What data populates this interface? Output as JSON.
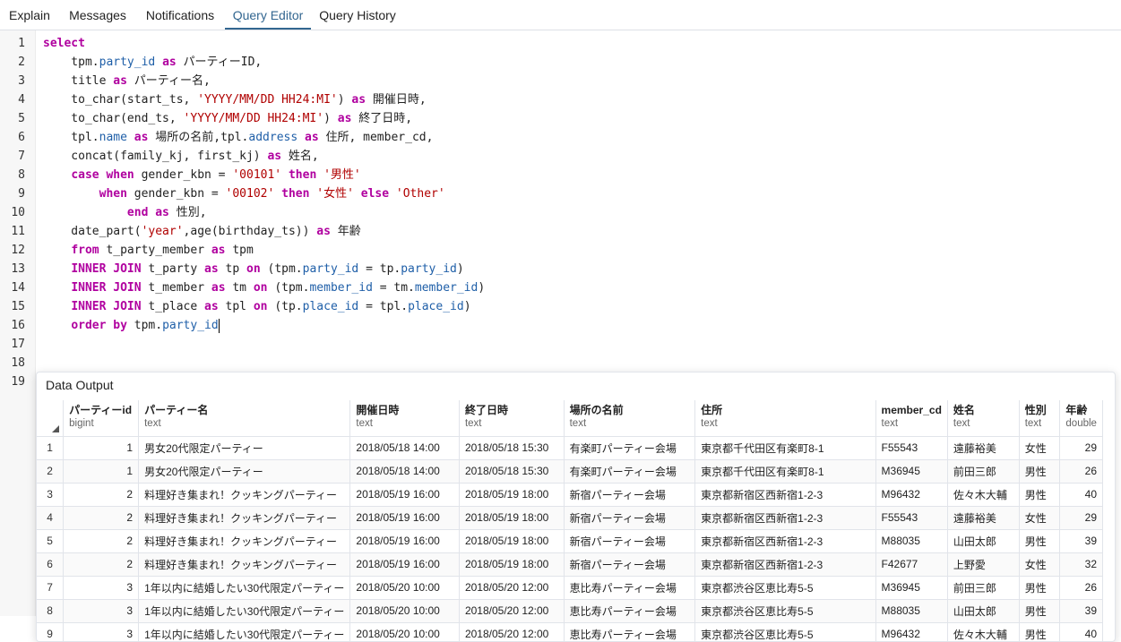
{
  "tabs": [
    {
      "label": "Explain",
      "active": false
    },
    {
      "label": "Messages",
      "active": false
    },
    {
      "label": "Notifications",
      "active": false
    },
    {
      "label": "Query Editor",
      "active": true
    },
    {
      "label": "Query History",
      "active": false
    }
  ],
  "editor": {
    "line_numbers": [
      "1",
      "2",
      "3",
      "4",
      "5",
      "6",
      "7",
      "8",
      "9",
      "10",
      "11",
      "12",
      "13",
      "14",
      "15",
      "16",
      "17",
      "18",
      "19"
    ],
    "lines": [
      [
        {
          "t": "select",
          "c": "kw"
        }
      ],
      [
        {
          "t": "    tpm."
        },
        {
          "t": "party_id",
          "c": "prop"
        },
        {
          "t": " "
        },
        {
          "t": "as",
          "c": "kw"
        },
        {
          "t": " パーティーID,"
        }
      ],
      [
        {
          "t": "    title "
        },
        {
          "t": "as",
          "c": "kw"
        },
        {
          "t": " パーティー名,"
        }
      ],
      [
        {
          "t": "    to_char(start_ts, "
        },
        {
          "t": "'YYYY/MM/DD HH24:MI'",
          "c": "str"
        },
        {
          "t": ") "
        },
        {
          "t": "as",
          "c": "kw"
        },
        {
          "t": " 開催日時,"
        }
      ],
      [
        {
          "t": "    to_char(end_ts, "
        },
        {
          "t": "'YYYY/MM/DD HH24:MI'",
          "c": "str"
        },
        {
          "t": ") "
        },
        {
          "t": "as",
          "c": "kw"
        },
        {
          "t": " 終了日時,"
        }
      ],
      [
        {
          "t": "    tpl."
        },
        {
          "t": "name",
          "c": "prop"
        },
        {
          "t": " "
        },
        {
          "t": "as",
          "c": "kw"
        },
        {
          "t": " 場所の名前,tpl."
        },
        {
          "t": "address",
          "c": "prop"
        },
        {
          "t": " "
        },
        {
          "t": "as",
          "c": "kw"
        },
        {
          "t": " 住所, member_cd,"
        }
      ],
      [
        {
          "t": "    concat(family_kj, first_kj) "
        },
        {
          "t": "as",
          "c": "kw"
        },
        {
          "t": " 姓名,"
        }
      ],
      [
        {
          "t": "    "
        },
        {
          "t": "case when",
          "c": "kw"
        },
        {
          "t": " gender_kbn = "
        },
        {
          "t": "'00101'",
          "c": "str"
        },
        {
          "t": " "
        },
        {
          "t": "then",
          "c": "kw"
        },
        {
          "t": " "
        },
        {
          "t": "'男性'",
          "c": "str"
        }
      ],
      [
        {
          "t": "        "
        },
        {
          "t": "when",
          "c": "kw"
        },
        {
          "t": " gender_kbn = "
        },
        {
          "t": "'00102'",
          "c": "str"
        },
        {
          "t": " "
        },
        {
          "t": "then",
          "c": "kw"
        },
        {
          "t": " "
        },
        {
          "t": "'女性'",
          "c": "str"
        },
        {
          "t": " "
        },
        {
          "t": "else",
          "c": "kw"
        },
        {
          "t": " "
        },
        {
          "t": "'Other'",
          "c": "str"
        }
      ],
      [
        {
          "t": "            "
        },
        {
          "t": "end as",
          "c": "kw"
        },
        {
          "t": " 性別,"
        }
      ],
      [
        {
          "t": "    date_part("
        },
        {
          "t": "'year'",
          "c": "str"
        },
        {
          "t": ",age(birthday_ts)) "
        },
        {
          "t": "as",
          "c": "kw"
        },
        {
          "t": " 年齢"
        }
      ],
      [
        {
          "t": "    "
        },
        {
          "t": "from",
          "c": "kw"
        },
        {
          "t": " t_party_member "
        },
        {
          "t": "as",
          "c": "kw"
        },
        {
          "t": " tpm"
        }
      ],
      [
        {
          "t": "    "
        },
        {
          "t": "INNER JOIN",
          "c": "kw"
        },
        {
          "t": " t_party "
        },
        {
          "t": "as",
          "c": "kw"
        },
        {
          "t": " tp "
        },
        {
          "t": "on",
          "c": "kw"
        },
        {
          "t": " (tpm."
        },
        {
          "t": "party_id",
          "c": "prop"
        },
        {
          "t": " = tp."
        },
        {
          "t": "party_id",
          "c": "prop"
        },
        {
          "t": ")"
        }
      ],
      [
        {
          "t": "    "
        },
        {
          "t": "INNER JOIN",
          "c": "kw"
        },
        {
          "t": " t_member "
        },
        {
          "t": "as",
          "c": "kw"
        },
        {
          "t": " tm "
        },
        {
          "t": "on",
          "c": "kw"
        },
        {
          "t": " (tpm."
        },
        {
          "t": "member_id",
          "c": "prop"
        },
        {
          "t": " = tm."
        },
        {
          "t": "member_id",
          "c": "prop"
        },
        {
          "t": ")"
        }
      ],
      [
        {
          "t": "    "
        },
        {
          "t": "INNER JOIN",
          "c": "kw"
        },
        {
          "t": " t_place "
        },
        {
          "t": "as",
          "c": "kw"
        },
        {
          "t": " tpl "
        },
        {
          "t": "on",
          "c": "kw"
        },
        {
          "t": " (tp."
        },
        {
          "t": "place_id",
          "c": "prop"
        },
        {
          "t": " = tpl."
        },
        {
          "t": "place_id",
          "c": "prop"
        },
        {
          "t": ")"
        }
      ],
      [
        {
          "t": "    "
        },
        {
          "t": "order by",
          "c": "kw"
        },
        {
          "t": " tpm."
        },
        {
          "t": "party_id",
          "c": "prop"
        },
        {
          "t": "",
          "c": "cursor"
        }
      ],
      [],
      [],
      []
    ]
  },
  "output": {
    "title": "Data Output",
    "columns": [
      {
        "name": "パーティーid",
        "type": "bigint",
        "num": true
      },
      {
        "name": "パーティー名",
        "type": "text"
      },
      {
        "name": "開催日時",
        "type": "text"
      },
      {
        "name": "終了日時",
        "type": "text"
      },
      {
        "name": "場所の名前",
        "type": "text"
      },
      {
        "name": "住所",
        "type": "text"
      },
      {
        "name": "member_cd",
        "type": "text"
      },
      {
        "name": "姓名",
        "type": "text"
      },
      {
        "name": "性別",
        "type": "text"
      },
      {
        "name": "年齢",
        "type": "double",
        "num": true
      }
    ],
    "rows": [
      [
        "1",
        "1",
        "男女20代限定パーティー",
        "2018/05/18 14:00",
        "2018/05/18 15:30",
        "有楽町パーティー会場",
        "東京都千代田区有楽町8-1",
        "F55543",
        "遠藤裕美",
        "女性",
        "29"
      ],
      [
        "2",
        "1",
        "男女20代限定パーティー",
        "2018/05/18 14:00",
        "2018/05/18 15:30",
        "有楽町パーティー会場",
        "東京都千代田区有楽町8-1",
        "M36945",
        "前田三郎",
        "男性",
        "26"
      ],
      [
        "3",
        "2",
        "料理好き集まれ！クッキングパーティー",
        "2018/05/19 16:00",
        "2018/05/19 18:00",
        "新宿パーティー会場",
        "東京都新宿区西新宿1-2-3",
        "M96432",
        "佐々木大輔",
        "男性",
        "40"
      ],
      [
        "4",
        "2",
        "料理好き集まれ！クッキングパーティー",
        "2018/05/19 16:00",
        "2018/05/19 18:00",
        "新宿パーティー会場",
        "東京都新宿区西新宿1-2-3",
        "F55543",
        "遠藤裕美",
        "女性",
        "29"
      ],
      [
        "5",
        "2",
        "料理好き集まれ！クッキングパーティー",
        "2018/05/19 16:00",
        "2018/05/19 18:00",
        "新宿パーティー会場",
        "東京都新宿区西新宿1-2-3",
        "M88035",
        "山田太郎",
        "男性",
        "39"
      ],
      [
        "6",
        "2",
        "料理好き集まれ！クッキングパーティー",
        "2018/05/19 16:00",
        "2018/05/19 18:00",
        "新宿パーティー会場",
        "東京都新宿区西新宿1-2-3",
        "F42677",
        "上野愛",
        "女性",
        "32"
      ],
      [
        "7",
        "3",
        "1年以内に結婚したい30代限定パーティー",
        "2018/05/20 10:00",
        "2018/05/20 12:00",
        "恵比寿パーティー会場",
        "東京都渋谷区恵比寿5-5",
        "M36945",
        "前田三郎",
        "男性",
        "26"
      ],
      [
        "8",
        "3",
        "1年以内に結婚したい30代限定パーティー",
        "2018/05/20 10:00",
        "2018/05/20 12:00",
        "恵比寿パーティー会場",
        "東京都渋谷区恵比寿5-5",
        "M88035",
        "山田太郎",
        "男性",
        "39"
      ],
      [
        "9",
        "3",
        "1年以内に結婚したい30代限定パーティー",
        "2018/05/20 10:00",
        "2018/05/20 12:00",
        "恵比寿パーティー会場",
        "東京都渋谷区恵比寿5-5",
        "M96432",
        "佐々木大輔",
        "男性",
        "40"
      ]
    ]
  }
}
